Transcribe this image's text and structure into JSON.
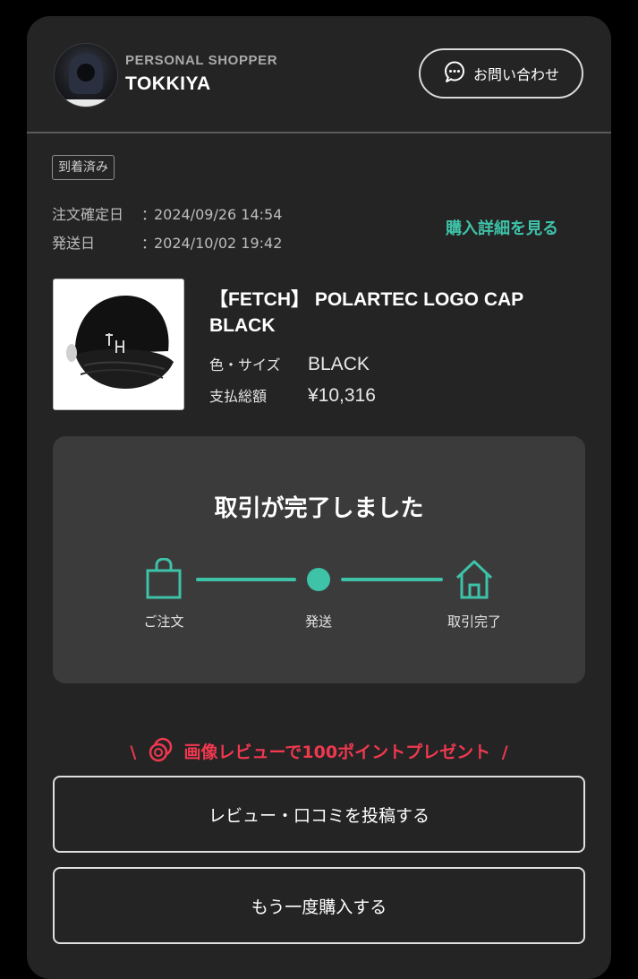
{
  "shopper": {
    "role": "PERSONAL SHOPPER",
    "name": "TOKKIYA"
  },
  "header": {
    "contact_label": "お問い合わせ"
  },
  "order": {
    "status_badge": "到着済み",
    "confirmed_label": "注文確定日",
    "confirmed_value": "2024/09/26 14:54",
    "shipped_label": "発送日",
    "shipped_value": "2024/10/02 19:42",
    "separator": "：",
    "detail_link": "購入詳細を見る"
  },
  "product": {
    "title": "【FETCH】 POLARTEC LOGO CAP BLACK",
    "color_size_label": "色・サイズ",
    "color_size_value": "BLACK",
    "total_label": "支払総額",
    "total_value": "¥10,316"
  },
  "progress": {
    "title": "取引が完了しました",
    "steps": [
      {
        "label": "ご注文",
        "icon": "shopping-bag-icon"
      },
      {
        "label": "発送",
        "icon": "dot-icon"
      },
      {
        "label": "取引完了",
        "icon": "house-icon"
      }
    ]
  },
  "promo": {
    "left_mark": "\\",
    "text": "画像レビューで100ポイントプレゼント",
    "right_mark": "/"
  },
  "actions": {
    "review_label": "レビュー・口コミを投稿する",
    "rebuy_label": "もう一度購入する"
  },
  "colors": {
    "background": "#000000",
    "card": "#242424",
    "panel": "#3b3b3b",
    "accent": "#3ec2a8",
    "promo": "#f0384f"
  }
}
